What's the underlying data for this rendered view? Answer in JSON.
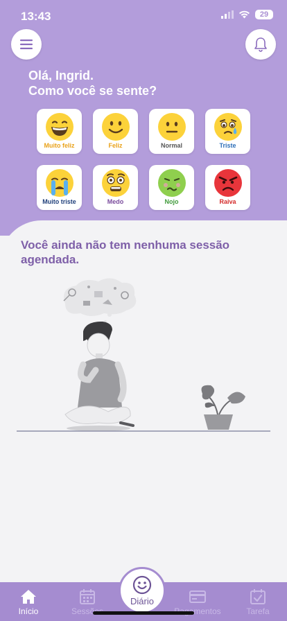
{
  "status": {
    "time": "13:43",
    "battery": "29"
  },
  "header": {
    "greeting_line1": "Olá, Ingrid.",
    "greeting_line2": "Como você se sente?"
  },
  "colors": {
    "header_bg": "#b39ddb",
    "tab_bg": "#a58cd0",
    "accent_text": "#7e5fa8"
  },
  "moods": [
    {
      "label": "Muito feliz",
      "color": "#e9a21a",
      "icon": "very-happy-face"
    },
    {
      "label": "Feliz",
      "color": "#e9a21a",
      "icon": "happy-face"
    },
    {
      "label": "Normal",
      "color": "#555555",
      "icon": "neutral-face"
    },
    {
      "label": "Triste",
      "color": "#2d6fb8",
      "icon": "sad-crying-face"
    },
    {
      "label": "Muito triste",
      "color": "#1f3f7a",
      "icon": "loudly-crying-face"
    },
    {
      "label": "Medo",
      "color": "#7a4b9c",
      "icon": "scared-face"
    },
    {
      "label": "Nojo",
      "color": "#3f9a3a",
      "icon": "nauseated-face"
    },
    {
      "label": "Raiva",
      "color": "#d42a2a",
      "icon": "angry-face"
    }
  ],
  "main": {
    "no_session_message": "Você ainda não tem nenhuma sessão agendada."
  },
  "tabs": {
    "inicio": "Início",
    "sessoes": "Sessões",
    "diario": "Diário",
    "pagamentos": "Pagamentos",
    "tarefa": "Tarefa"
  }
}
